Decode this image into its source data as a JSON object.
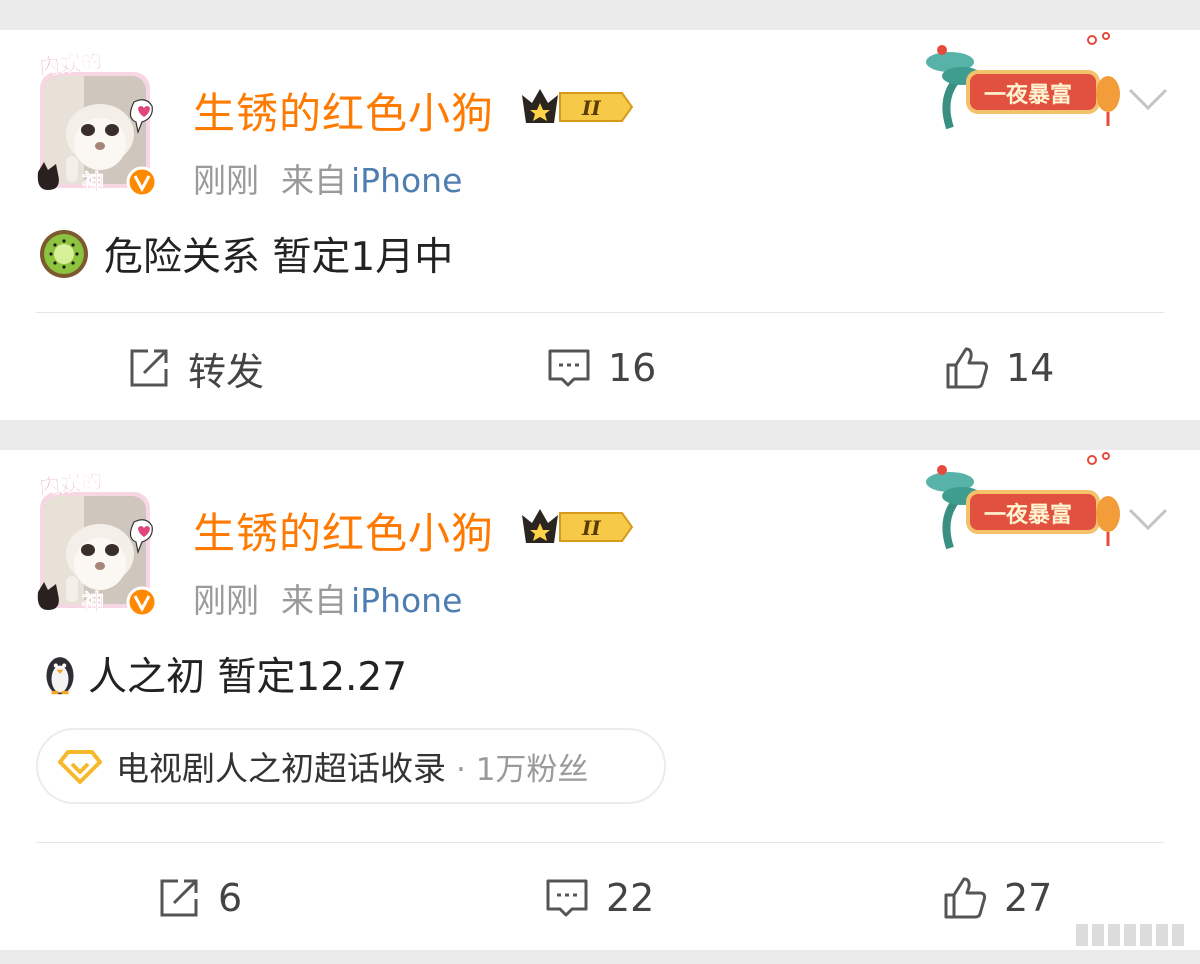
{
  "posts": [
    {
      "username": "生锈的红色小狗",
      "level": "II",
      "avatar_text_top": "内娱的",
      "avatar_text_bottom": "神",
      "time": "刚刚",
      "from_label": "来自",
      "source": "iPhone",
      "fortune_badge_text": "一夜暴富",
      "emoji": "kiwi-icon",
      "text": "危险关系 暂定1月中",
      "actions": {
        "repost": "转发",
        "comments": "16",
        "likes": "14"
      }
    },
    {
      "username": "生锈的红色小狗",
      "level": "II",
      "avatar_text_top": "内娱的",
      "avatar_text_bottom": "神",
      "time": "刚刚",
      "from_label": "来自",
      "source": "iPhone",
      "fortune_badge_text": "一夜暴富",
      "emoji": "penguin-icon",
      "text": "人之初 暂定12.27",
      "topic": {
        "name": "电视剧人之初超话收录",
        "fans": "· 1万粉丝"
      },
      "actions": {
        "repost": "6",
        "comments": "22",
        "likes": "27"
      }
    }
  ],
  "colors": {
    "username": "#ff7a00",
    "source": "#4e7eb0",
    "meta": "#9a9a9a",
    "background": "#ebebeb"
  }
}
